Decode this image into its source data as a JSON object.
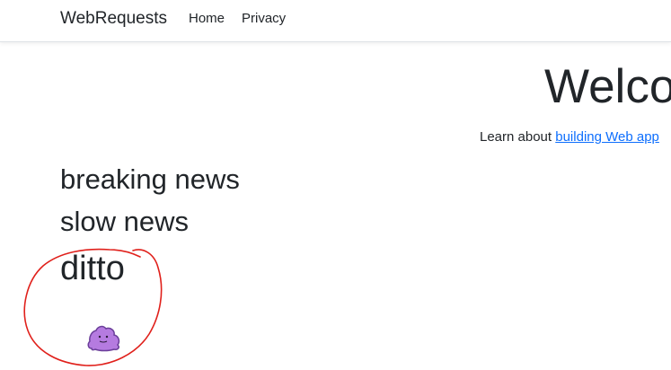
{
  "navbar": {
    "brand": "WebRequests",
    "links": [
      {
        "label": "Home"
      },
      {
        "label": "Privacy"
      }
    ]
  },
  "hero": {
    "title": "Welco",
    "learn_prefix": "Learn about ",
    "learn_link": "building Web app"
  },
  "news": {
    "items": [
      {
        "label": "breaking news"
      },
      {
        "label": "slow news"
      },
      {
        "label": "ditto"
      }
    ]
  },
  "image": {
    "icon": "ditto-pokemon-icon",
    "annotation_color": "#e0201b",
    "sprite_color": "#b57be0"
  }
}
